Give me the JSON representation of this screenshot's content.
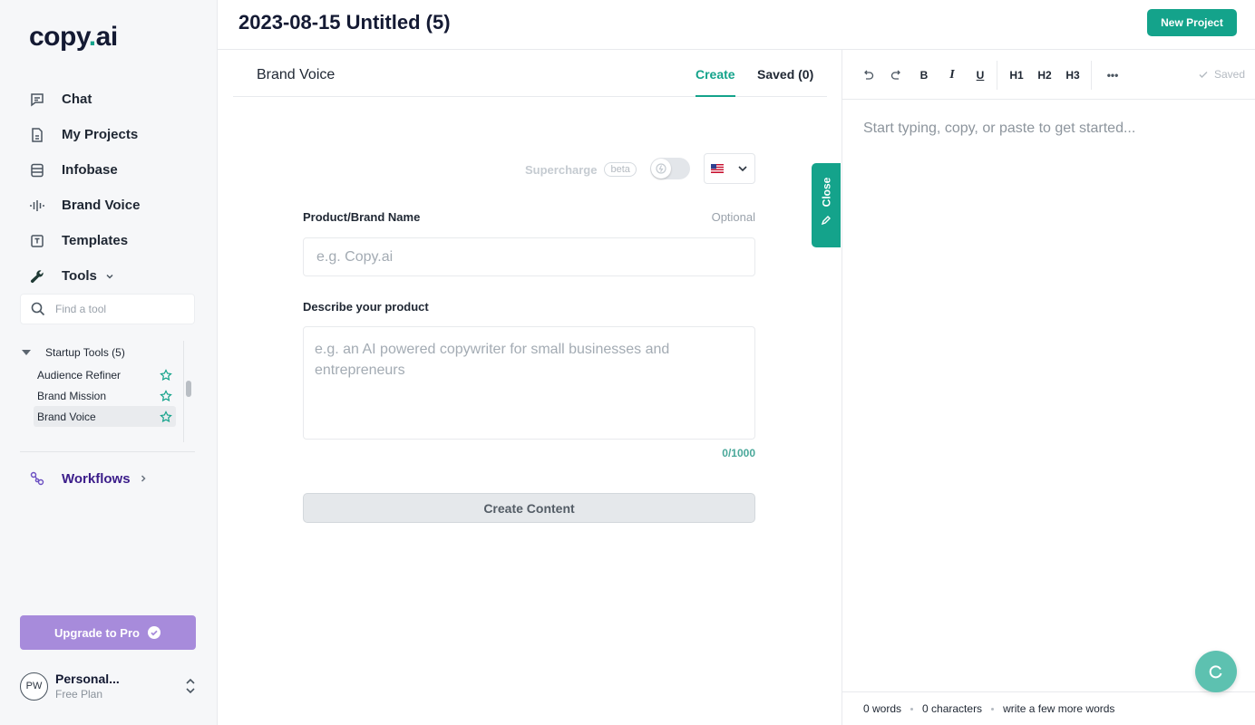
{
  "brand": {
    "logo_text_1": "copy",
    "logo_dot": ".",
    "logo_text_2": "ai",
    "accent_color": "#14a38b",
    "purple_color": "#a78bdb"
  },
  "sidebar": {
    "nav": [
      {
        "label": "Chat",
        "icon": "chat-icon"
      },
      {
        "label": "My Projects",
        "icon": "document-icon"
      },
      {
        "label": "Infobase",
        "icon": "database-icon"
      },
      {
        "label": "Brand Voice",
        "icon": "soundwave-icon"
      },
      {
        "label": "Templates",
        "icon": "template-icon"
      },
      {
        "label": "Tools",
        "icon": "wrench-icon"
      }
    ],
    "tool_search_placeholder": "Find a tool",
    "tool_group": "Startup Tools (5)",
    "tools": [
      {
        "label": "Audience Refiner"
      },
      {
        "label": "Brand Mission"
      },
      {
        "label": "Brand Voice",
        "active": true
      }
    ],
    "workflows_label": "Workflows",
    "upgrade_label": "Upgrade to Pro",
    "account": {
      "initials": "PW",
      "name": "Personal...",
      "plan": "Free Plan"
    }
  },
  "header": {
    "title": "2023-08-15 Untitled (5)",
    "new_project_label": "New Project"
  },
  "panel": {
    "title": "Brand Voice",
    "tabs": {
      "create": "Create",
      "saved": "Saved (0)"
    },
    "supercharge_label": "Supercharge",
    "beta_label": "beta",
    "fields": {
      "name_label": "Product/Brand Name",
      "name_optional": "Optional",
      "name_placeholder": "e.g. Copy.ai",
      "desc_label": "Describe your product",
      "desc_placeholder": "e.g. an AI powered copywriter for small businesses and entrepreneurs",
      "counter": "0/1000"
    },
    "create_button": "Create Content",
    "close_label": "Close"
  },
  "editor": {
    "toolbar": {
      "bold": "B",
      "italic": "I",
      "underline": "U",
      "h1": "H1",
      "h2": "H2",
      "h3": "H3",
      "more": "•••",
      "saved": "Saved"
    },
    "placeholder": "Start typing, copy, or paste to get started...",
    "footer": {
      "words": "0 words",
      "characters": "0 characters",
      "hint": "write a few more words"
    }
  }
}
